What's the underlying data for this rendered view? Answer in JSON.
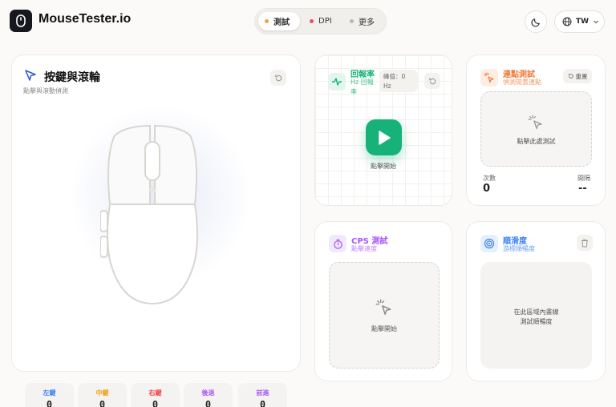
{
  "app": {
    "title": "MouseTester.io"
  },
  "nav": {
    "tabs": [
      {
        "label": "測試",
        "dot_color": "#f0a04b"
      },
      {
        "label": "DPI",
        "dot_color": "#e8506a"
      },
      {
        "label": "更多",
        "dot_color": "#b8b8b8"
      }
    ]
  },
  "header": {
    "language": "TW"
  },
  "buttons_card": {
    "title": "按鍵與滾輪",
    "subtitle": "點擊與滾動偵測",
    "counters": [
      {
        "label": "左鍵",
        "value": "0",
        "color": "#3b82f6"
      },
      {
        "label": "中鍵",
        "value": "0",
        "color": "#f59e0b"
      },
      {
        "label": "右鍵",
        "value": "0",
        "color": "#ef4444"
      },
      {
        "label": "後退",
        "value": "0",
        "color": "#a855f7"
      },
      {
        "label": "前進",
        "value": "0",
        "color": "#a855f7"
      }
    ]
  },
  "polling_card": {
    "title": "回報率",
    "subtitle": "Hz 回報率",
    "peak_label": "峰值：0 Hz",
    "start_label": "點擊開始",
    "accent": "#16b27a"
  },
  "double_click_card": {
    "title": "連點測試",
    "subtitle": "偵測閒置連點",
    "reset_label": "重置",
    "zone_text": "點擊此處測試",
    "count_label": "次數",
    "count_value": "0",
    "interval_label": "間隔",
    "interval_value": "--",
    "accent": "#f07a3a"
  },
  "cps_card": {
    "title": "CPS 測試",
    "subtitle": "點擊速度",
    "zone_text": "點擊開始",
    "accent": "#a855f7"
  },
  "smooth_card": {
    "title": "順滑度",
    "subtitle": "游標順暢度",
    "zone_line1": "在此區域內畫線",
    "zone_line2": "測試順暢度",
    "accent": "#3b82f6"
  }
}
